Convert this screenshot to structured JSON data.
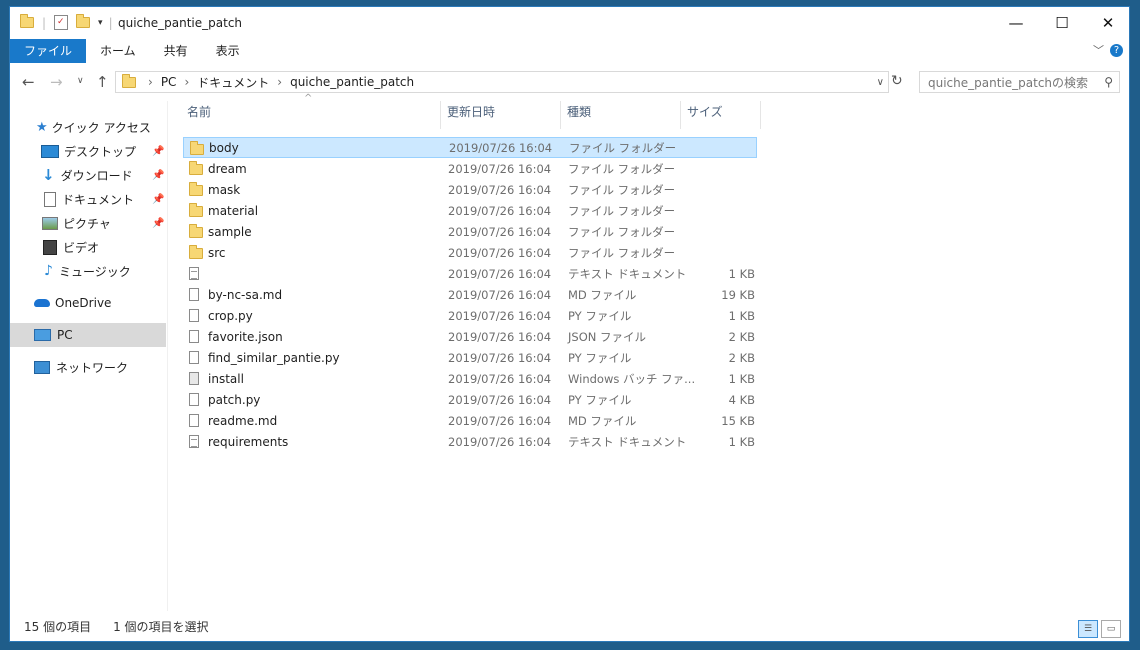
{
  "window": {
    "title": "quiche_pantie_patch",
    "minimize_glyph": "—",
    "maximize_glyph": "☐",
    "close_glyph": "✕"
  },
  "ribbon": {
    "tabs": [
      {
        "label": "ファイル"
      },
      {
        "label": "ホーム"
      },
      {
        "label": "共有"
      },
      {
        "label": "表示"
      }
    ],
    "expand_glyph": "﹀",
    "help_glyph": "?"
  },
  "nav": {
    "back_glyph": "←",
    "forward_glyph": "→",
    "recent_glyph": "∨",
    "up_glyph": "↑"
  },
  "address": {
    "segments": [
      "PC",
      "ドキュメント",
      "quiche_pantie_patch"
    ],
    "separator": "›",
    "refresh_glyph": "↻"
  },
  "search": {
    "placeholder": "quiche_pantie_patchの検索"
  },
  "sidebar": {
    "quick_access": "クイック アクセス",
    "items": [
      {
        "label": "デスクトップ",
        "pinned": true
      },
      {
        "label": "ダウンロード",
        "pinned": true
      },
      {
        "label": "ドキュメント",
        "pinned": true
      },
      {
        "label": "ピクチャ",
        "pinned": true
      },
      {
        "label": "ビデオ",
        "pinned": false
      },
      {
        "label": "ミュージック",
        "pinned": false
      }
    ],
    "onedrive": "OneDrive",
    "pc": "PC",
    "network": "ネットワーク"
  },
  "columns": {
    "name": "名前",
    "modified": "更新日時",
    "type": "種類",
    "size": "サイズ",
    "sort_glyph": "^"
  },
  "files": [
    {
      "name": "body",
      "date": "2019/07/26 16:04",
      "type": "ファイル フォルダー",
      "size": "",
      "kind": "folder",
      "selected": true
    },
    {
      "name": "dream",
      "date": "2019/07/26 16:04",
      "type": "ファイル フォルダー",
      "size": "",
      "kind": "folder"
    },
    {
      "name": "mask",
      "date": "2019/07/26 16:04",
      "type": "ファイル フォルダー",
      "size": "",
      "kind": "folder"
    },
    {
      "name": "material",
      "date": "2019/07/26 16:04",
      "type": "ファイル フォルダー",
      "size": "",
      "kind": "folder"
    },
    {
      "name": "sample",
      "date": "2019/07/26 16:04",
      "type": "ファイル フォルダー",
      "size": "",
      "kind": "folder"
    },
    {
      "name": "src",
      "date": "2019/07/26 16:04",
      "type": "ファイル フォルダー",
      "size": "",
      "kind": "folder"
    },
    {
      "name": "",
      "date": "2019/07/26 16:04",
      "type": "テキスト ドキュメント",
      "size": "1 KB",
      "kind": "text"
    },
    {
      "name": "by-nc-sa.md",
      "date": "2019/07/26 16:04",
      "type": "MD ファイル",
      "size": "19 KB",
      "kind": "file"
    },
    {
      "name": "crop.py",
      "date": "2019/07/26 16:04",
      "type": "PY ファイル",
      "size": "1 KB",
      "kind": "file"
    },
    {
      "name": "favorite.json",
      "date": "2019/07/26 16:04",
      "type": "JSON ファイル",
      "size": "2 KB",
      "kind": "file"
    },
    {
      "name": "find_similar_pantie.py",
      "date": "2019/07/26 16:04",
      "type": "PY ファイル",
      "size": "2 KB",
      "kind": "file"
    },
    {
      "name": "install",
      "date": "2019/07/26 16:04",
      "type": "Windows バッチ ファ...",
      "size": "1 KB",
      "kind": "bat"
    },
    {
      "name": "patch.py",
      "date": "2019/07/26 16:04",
      "type": "PY ファイル",
      "size": "4 KB",
      "kind": "file"
    },
    {
      "name": "readme.md",
      "date": "2019/07/26 16:04",
      "type": "MD ファイル",
      "size": "15 KB",
      "kind": "file"
    },
    {
      "name": "requirements",
      "date": "2019/07/26 16:04",
      "type": "テキスト ドキュメント",
      "size": "1 KB",
      "kind": "text"
    }
  ],
  "status": {
    "item_count": "15 個の項目",
    "selected": "1 個の項目を選択"
  },
  "colors": {
    "accent": "#1979ca",
    "selection_bg": "#cce8ff",
    "folder": "#f7d774"
  }
}
